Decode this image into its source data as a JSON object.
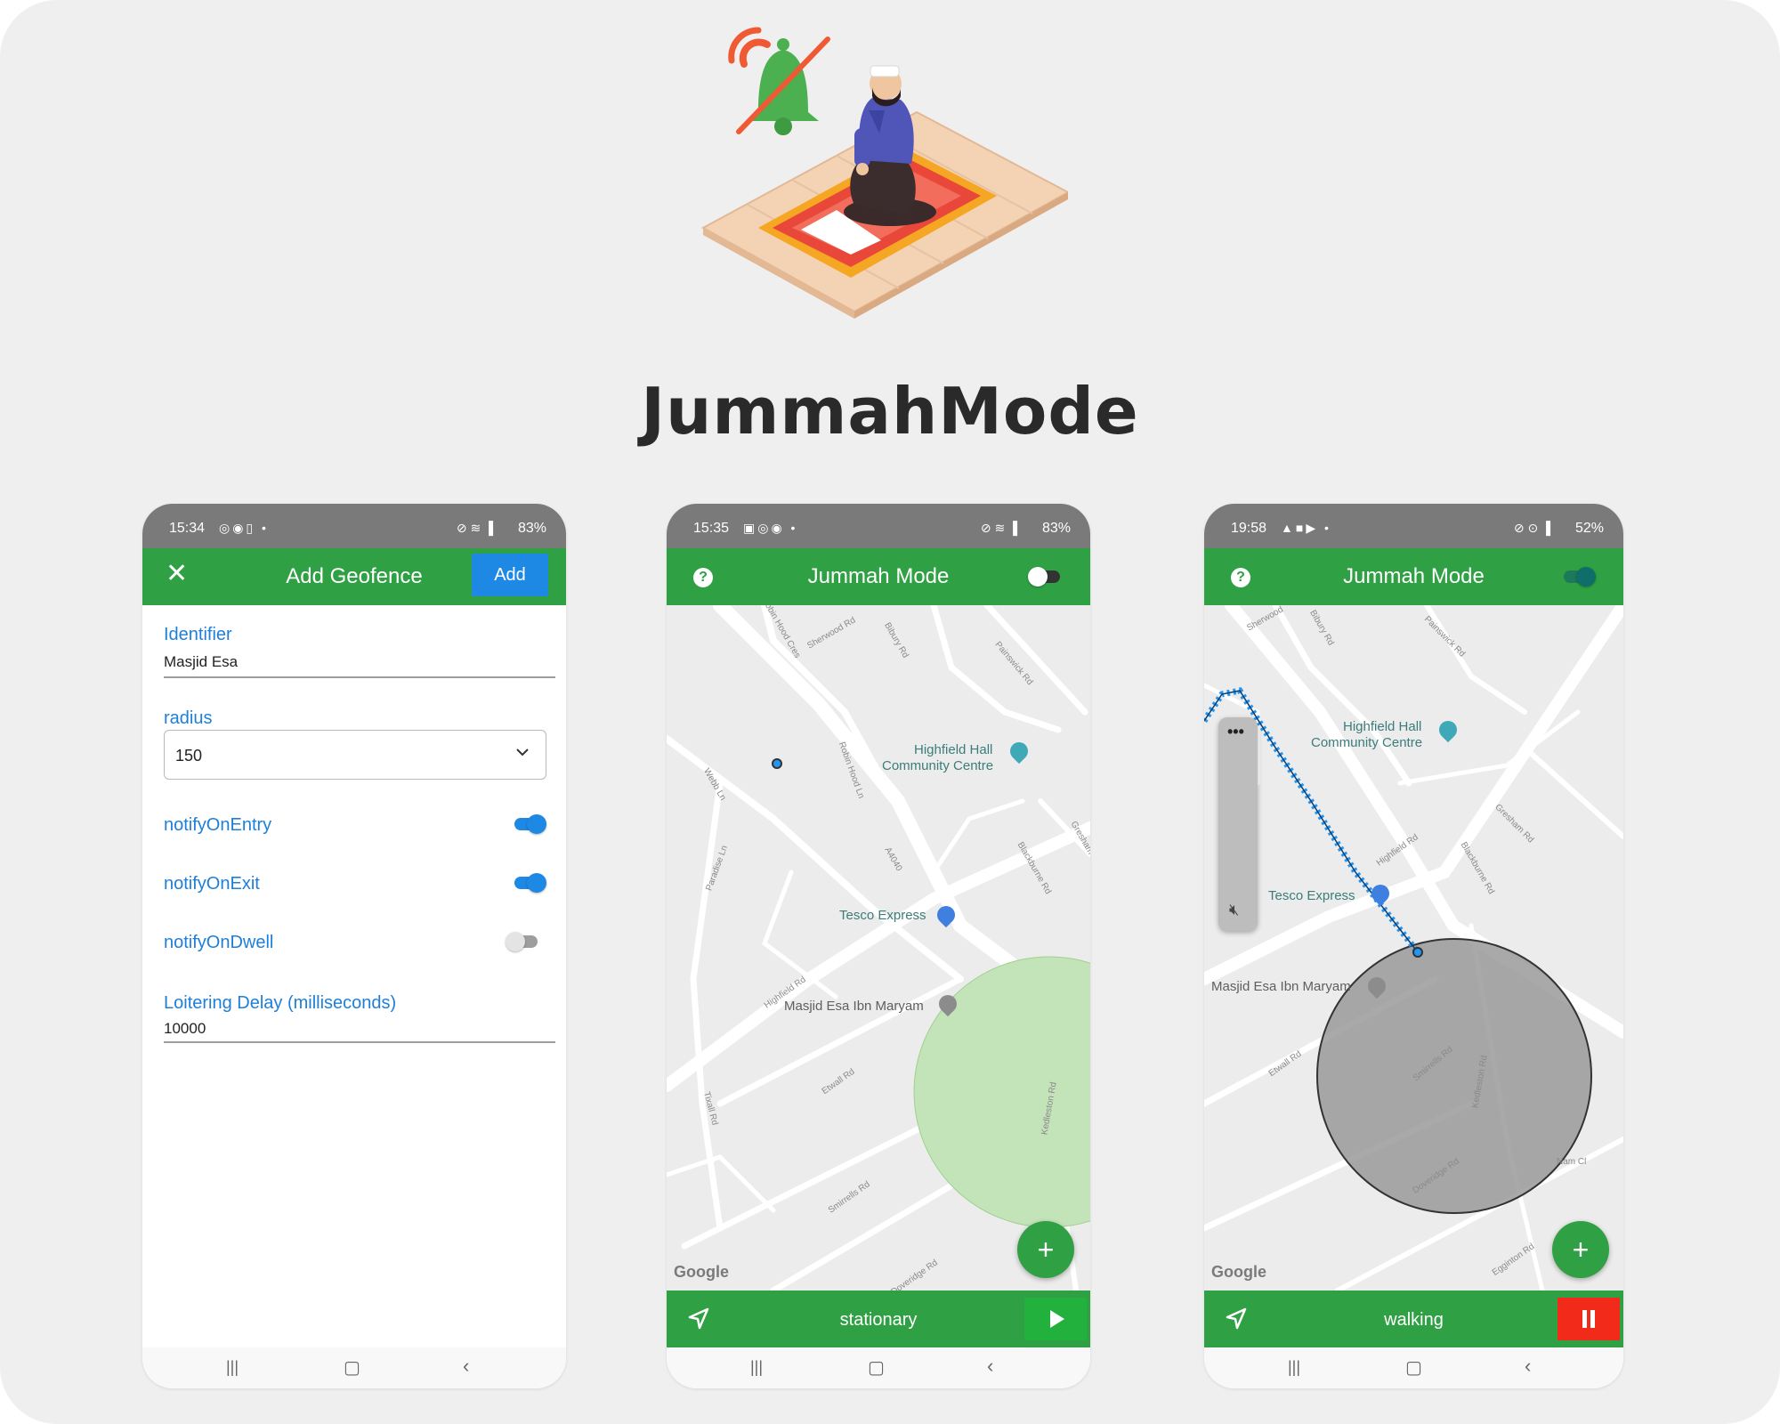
{
  "brand": {
    "title": "JummahMode"
  },
  "phones": [
    {
      "status": {
        "time": "15:34",
        "battery": "83%"
      },
      "appbar": {
        "title": "Add Geofence",
        "add_label": "Add"
      },
      "form": {
        "identifier_label": "Identifier",
        "identifier_value": "Masjid Esa",
        "radius_label": "radius",
        "radius_value": "150",
        "notify_entry_label": "notifyOnEntry",
        "notify_entry_on": true,
        "notify_exit_label": "notifyOnExit",
        "notify_exit_on": true,
        "notify_dwell_label": "notifyOnDwell",
        "notify_dwell_on": false,
        "loitering_label": "Loitering Delay (milliseconds)",
        "loitering_value": "10000"
      }
    },
    {
      "status": {
        "time": "15:35",
        "battery": "83%"
      },
      "appbar": {
        "title": "Jummah Mode",
        "help": "?"
      },
      "map": {
        "places": [
          "Highfield Hall",
          "Community Centre",
          "Tesco Express",
          "Masjid Esa Ibn Maryam"
        ],
        "roads": [
          "Sherwood Rd",
          "Bibury Rd",
          "Painswick Rd",
          "Webb Ln",
          "Robin Hood Ln",
          "A4040",
          "Blackburne Rd",
          "Paradise Ln",
          "Highfield Rd",
          "Etwall Rd",
          "Tixall Rd",
          "Smirrells Rd",
          "Kedleston Rd",
          "Robin Hood Cres",
          "Gresham",
          "Doveridge Rd"
        ],
        "google": "Google"
      },
      "bottom": {
        "status": "stationary"
      }
    },
    {
      "status": {
        "time": "19:58",
        "battery": "52%"
      },
      "appbar": {
        "title": "Jummah Mode",
        "help": "?"
      },
      "map": {
        "places": [
          "Highfield Hall",
          "Community Centre",
          "Tesco Express",
          "Masjid Esa Ibn Maryam"
        ],
        "roads": [
          "Sherwood",
          "Bibury Rd",
          "Painswick Rd",
          "Gresham Rd",
          "Highfield Rd",
          "Blackburne Rd",
          "Etwall Rd",
          "Smirrells Rd",
          "Kedleston Rd",
          "Doveridge Rd",
          "Egginton Rd",
          "Nam Cl"
        ],
        "google": "Google"
      },
      "bottom": {
        "status": "walking"
      }
    }
  ]
}
